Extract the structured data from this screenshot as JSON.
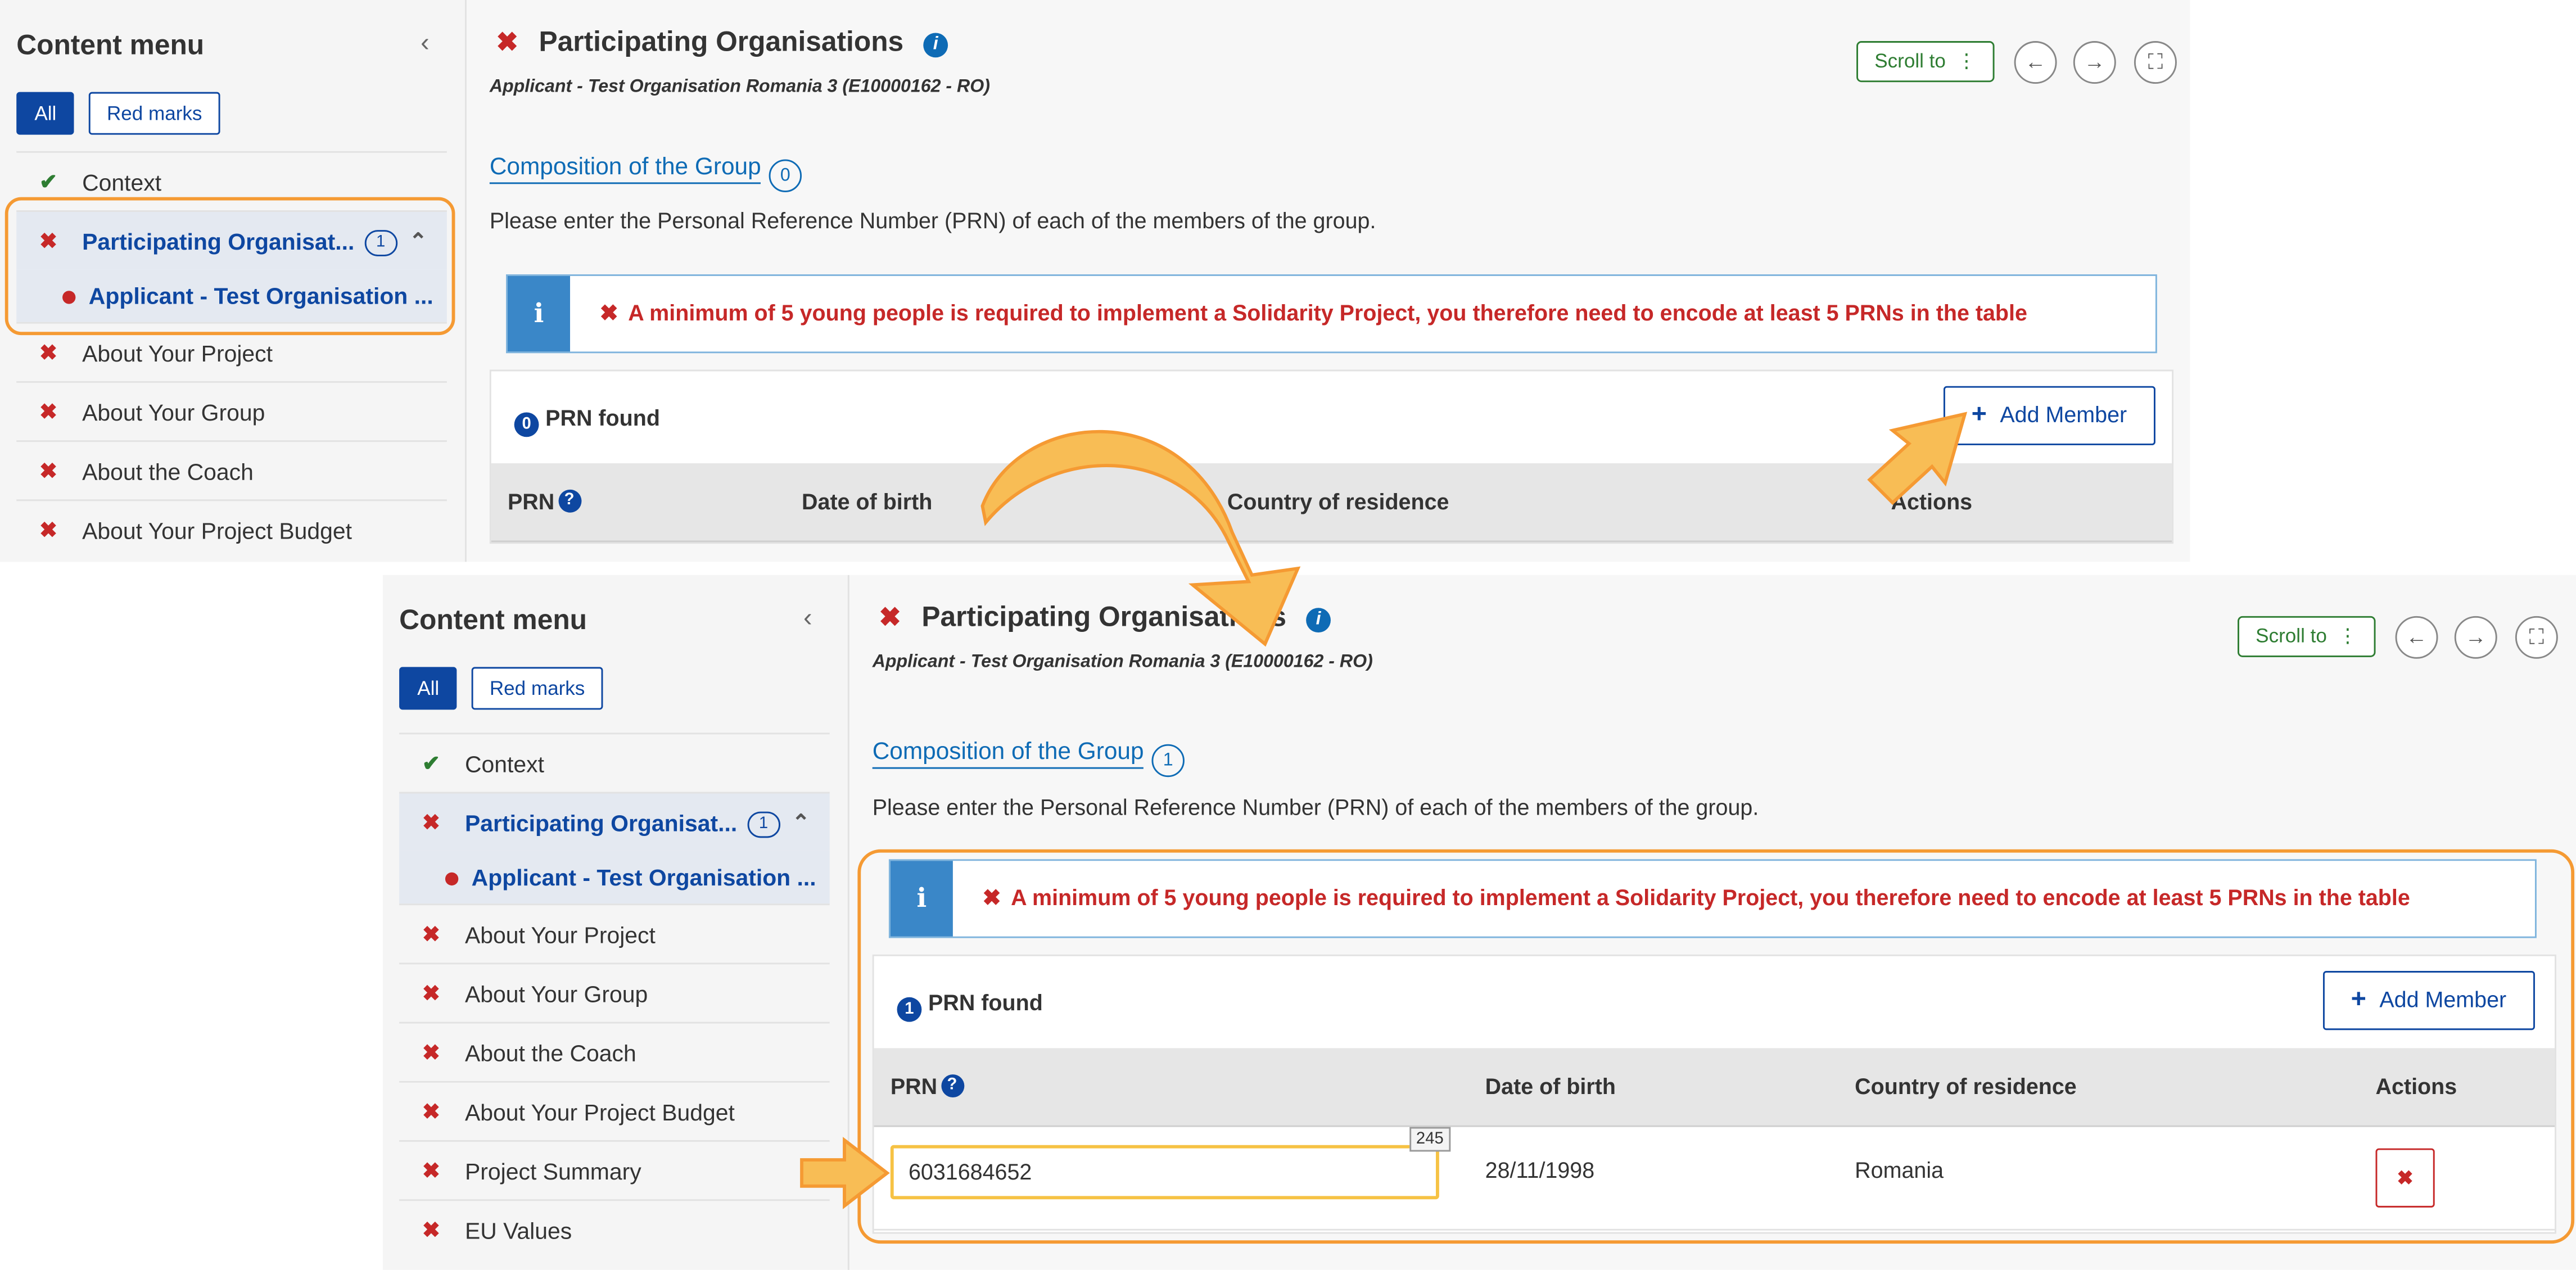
{
  "colors": {
    "primary": "#0e47a1",
    "error": "#c62828",
    "success": "#2e7d32",
    "highlight": "#f59a33",
    "input_focus": "#f6c244"
  },
  "sidebar": {
    "title": "Content menu",
    "filters": {
      "all": "All",
      "red_marks": "Red marks"
    }
  },
  "shot1": {
    "items": [
      {
        "label": "Context",
        "status": "check-icon"
      },
      {
        "label": "Participating Organisat...",
        "status": "x-icon",
        "badge": "1",
        "expanded": true
      },
      {
        "label": "Applicant - Test Organisation ...",
        "status": "dot-icon",
        "sub": true
      },
      {
        "label": "About Your Project",
        "status": "x-icon"
      },
      {
        "label": "About Your Group",
        "status": "x-icon"
      },
      {
        "label": "About the Coach",
        "status": "x-icon"
      },
      {
        "label": "About Your Project Budget",
        "status": "x-icon"
      }
    ],
    "group_count": "0",
    "prn_found_count": "0"
  },
  "shot2": {
    "items": [
      {
        "label": "Context",
        "status": "check-icon"
      },
      {
        "label": "Participating Organisat...",
        "status": "x-icon",
        "badge": "1",
        "expanded": true
      },
      {
        "label": "Applicant - Test Organisation ...",
        "status": "dot-icon",
        "sub": true
      },
      {
        "label": "About Your Project",
        "status": "x-icon"
      },
      {
        "label": "About Your Group",
        "status": "x-icon"
      },
      {
        "label": "About the Coach",
        "status": "x-icon"
      },
      {
        "label": "About Your Project Budget",
        "status": "x-icon"
      },
      {
        "label": "Project Summary",
        "status": "x-icon"
      },
      {
        "label": "EU Values",
        "status": "x-icon"
      }
    ],
    "group_count": "1",
    "prn_found_count": "1",
    "row": {
      "prn": "6031684652",
      "char_counter": "245",
      "date_of_birth": "28/11/1998",
      "country": "Romania"
    }
  },
  "header": {
    "title": "Participating Organisations",
    "subtitle": "Applicant - Test Organisation Romania 3 (E10000162 - RO)",
    "scroll_to": "Scroll to"
  },
  "section": {
    "title": "Composition of the Group",
    "description": "Please enter the Personal Reference Number (PRN) of each of the members of the group.",
    "alert": "A minimum of 5 young people is required to implement a Solidarity Project, you therefore need to encode at least 5 PRNs in the table",
    "prn_found": "PRN found",
    "add_member": "Add Member"
  },
  "table": {
    "col_prn": "PRN",
    "col_dob": "Date of birth",
    "col_country": "Country of residence",
    "col_actions": "Actions"
  }
}
